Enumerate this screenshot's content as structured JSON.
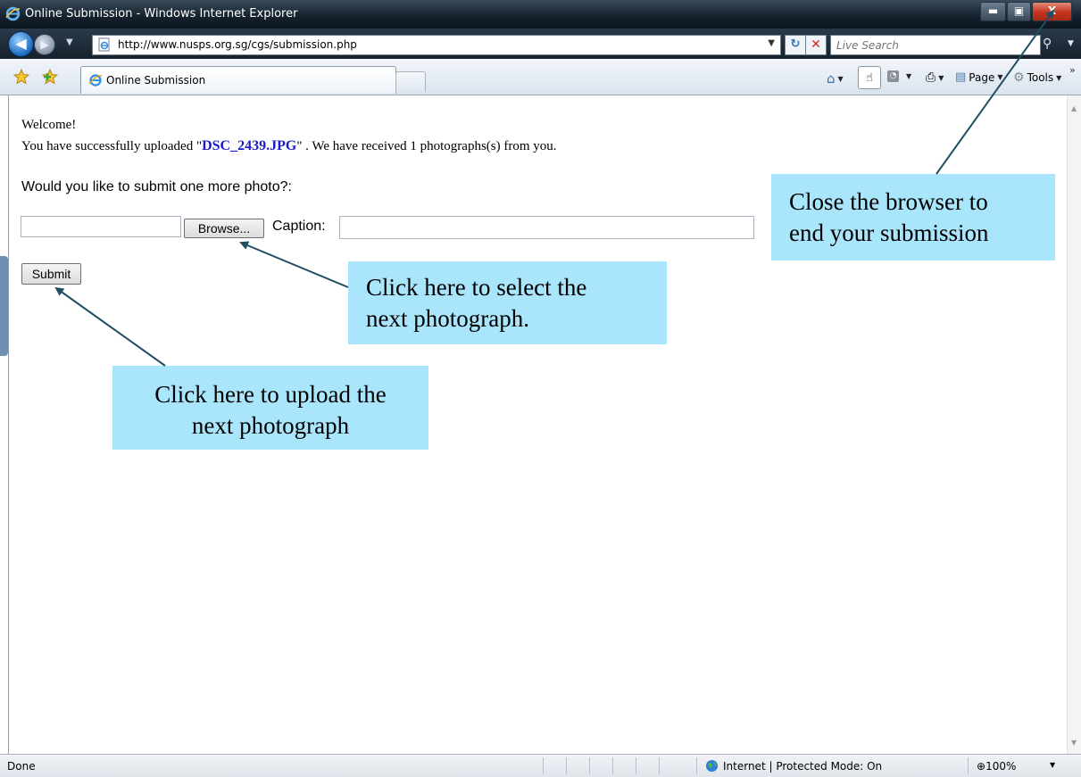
{
  "window": {
    "title": "Online Submission - Windows Internet Explorer",
    "minimize_glyph": "▬",
    "maximize_glyph": "▣",
    "close_glyph": "X"
  },
  "address_bar": {
    "url": "http://www.nusps.org.sg/cgs/submission.php",
    "search_placeholder": "Live Search"
  },
  "tabs": [
    {
      "label": "Online Submission"
    }
  ],
  "command_bar": {
    "page_label": "Page",
    "tools_label": "Tools"
  },
  "page": {
    "welcome": "Welcome!",
    "upload_prefix": "You have successfully uploaded \"",
    "uploaded_filename": "DSC_2439.JPG",
    "upload_suffix": "\" . We have received 1 photographs(s) from you.",
    "question": "Would you like to submit one more photo?:",
    "file_input_value": "",
    "browse_label": "Browse...",
    "caption_label": "Caption:",
    "caption_value": "",
    "submit_label": "Submit"
  },
  "callouts": {
    "close_line1": "Close the browser to",
    "close_line2": "end your submission",
    "select_line1": "Click here to select the",
    "select_line2": "next photograph.",
    "upload_line1": "Click here to upload the",
    "upload_line2": "next photograph"
  },
  "status_bar": {
    "status": "Done",
    "zone": "Internet | Protected Mode: On",
    "zoom": "100%"
  },
  "colors": {
    "callout_bg": "#a9e5fb",
    "arrow": "#1f4f63",
    "filename_link": "#1a1acc",
    "close_button": "#c4341d"
  },
  "icons": [
    "ie-logo-icon",
    "back-icon",
    "forward-icon",
    "page-icon",
    "refresh-icon",
    "stop-icon",
    "search-icon",
    "favorites-star-icon",
    "add-favorites-icon",
    "home-icon",
    "hand-icon",
    "feed-icon",
    "print-icon",
    "page-menu-icon",
    "tools-gear-icon",
    "globe-icon",
    "zoom-icon"
  ]
}
